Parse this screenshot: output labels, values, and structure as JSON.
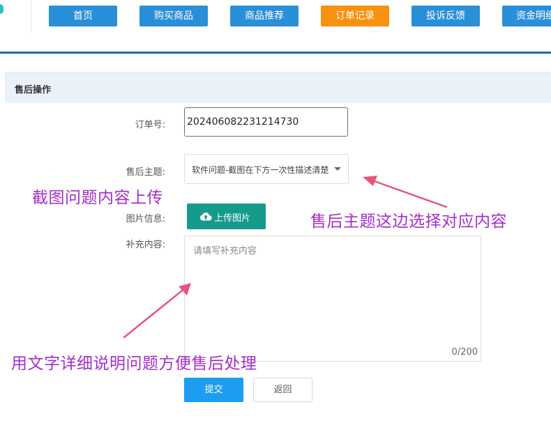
{
  "nav": {
    "items": [
      {
        "label": "首页"
      },
      {
        "label": "购买商品"
      },
      {
        "label": "商品推荐"
      },
      {
        "label": "订单记录"
      },
      {
        "label": "投诉反馈"
      },
      {
        "label": "资金明细"
      }
    ],
    "active_index": 3,
    "accent_color": "#2a8fd9",
    "active_color": "#f7910f"
  },
  "panel": {
    "title": "售后操作"
  },
  "form": {
    "order_label": "订单号:",
    "order_value": "202406082231214730",
    "subject_label": "售后主题:",
    "subject_value": "软件问题-截图在下方一次性描述清楚",
    "image_label": "图片信息:",
    "upload_label": "上传图片",
    "upload_icon": "cloud-upload-icon",
    "extra_label": "补充内容:",
    "extra_placeholder": "请填写补充内容",
    "counter": "0/200",
    "submit_label": "提交",
    "back_label": "返回"
  },
  "annotations": {
    "upload_hint": "截图问题内容上传",
    "subject_hint": "售后主题这边选择对应内容",
    "detail_hint": "用文字详细说明问题方便售后处理",
    "color": "#a32ec8",
    "arrow_color": "#e4567c"
  }
}
